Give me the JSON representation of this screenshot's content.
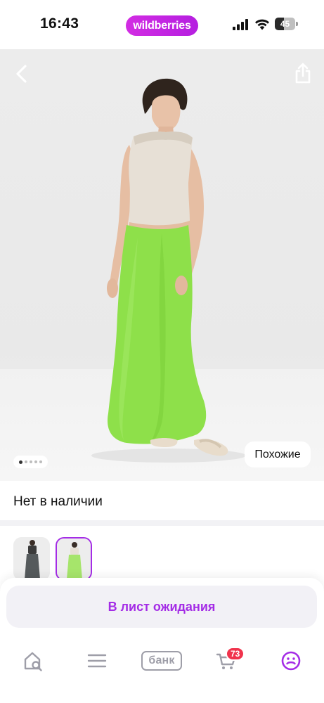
{
  "status_bar": {
    "time": "16:43",
    "brand": "wildberries",
    "battery_level": "45"
  },
  "product": {
    "similar_button": "Похожие",
    "photo_count": 5,
    "photo_active_index": 1,
    "availability": "Нет в наличии",
    "selected_color_index": 2
  },
  "actions": {
    "waitlist_button": "В лист ожидания"
  },
  "bottom_nav": {
    "bank_label": "банк",
    "cart_count": "73",
    "items": [
      "home-search",
      "catalog",
      "bank",
      "cart",
      "profile"
    ]
  },
  "colors": {
    "accent": "#a42ce6",
    "brand_gradient_start": "#d22ce3",
    "brand_gradient_end": "#b51fe0",
    "badge": "#f0334c",
    "skirt_green": "#8ee04a",
    "nav_icon_gray": "#9e9ea8"
  },
  "icons": {
    "back": "chevron-left-icon",
    "share": "share-icon",
    "home": "home-search-icon",
    "catalog": "menu-icon",
    "cart": "cart-icon",
    "profile": "profile-smile-icon"
  }
}
